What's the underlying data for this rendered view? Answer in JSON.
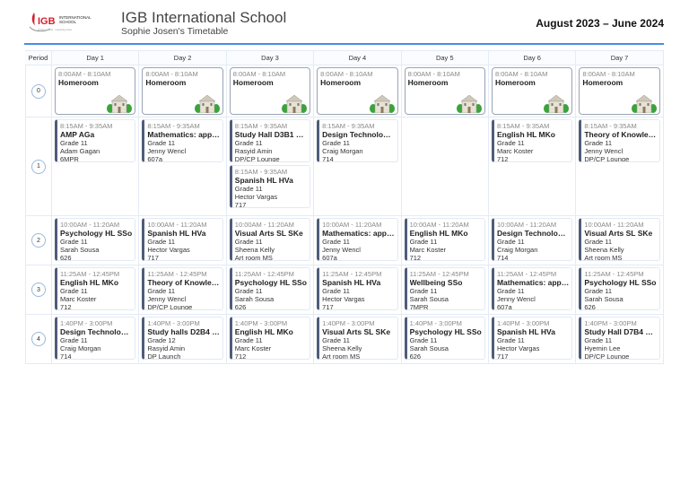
{
  "header": {
    "logo_text": "IGB INTERNATIONAL SCHOOL",
    "title": "IGB International School",
    "subtitle": "Sophie Josen's Timetable",
    "date_range": "August 2023 – June 2024"
  },
  "columns": [
    "Period",
    "Day 1",
    "Day 2",
    "Day 3",
    "Day 4",
    "Day 5",
    "Day 6",
    "Day 7"
  ],
  "periods": [
    {
      "num": "0",
      "days": [
        [
          {
            "time": "8:00AM - 8:10AM",
            "name": "Homeroom",
            "icon": "school-building-icon"
          }
        ],
        [
          {
            "time": "8:00AM - 8:10AM",
            "name": "Homeroom",
            "icon": "school-building-icon"
          }
        ],
        [
          {
            "time": "8:00AM - 8:10AM",
            "name": "Homeroom",
            "icon": "school-building-icon"
          }
        ],
        [
          {
            "time": "8:00AM - 8:10AM",
            "name": "Homeroom",
            "icon": "school-building-icon"
          }
        ],
        [
          {
            "time": "8:00AM - 8:10AM",
            "name": "Homeroom",
            "icon": "school-building-icon"
          }
        ],
        [
          {
            "time": "8:00AM - 8:10AM",
            "name": "Homeroom",
            "icon": "school-building-icon"
          }
        ],
        [
          {
            "time": "8:00AM - 8:10AM",
            "name": "Homeroom",
            "icon": "school-building-icon"
          }
        ]
      ]
    },
    {
      "num": "1",
      "days": [
        [
          {
            "time": "8:15AM - 9:35AM",
            "name": "AMP AGa",
            "grade": "Grade 11",
            "teacher": "Adam Gagan",
            "room": "6MPR"
          }
        ],
        [
          {
            "time": "8:15AM - 9:35AM",
            "name": "Mathematics: appli...",
            "grade": "Grade 11",
            "teacher": "Jenny Wencl",
            "room": "607a"
          }
        ],
        [
          {
            "time": "8:15AM - 9:35AM",
            "name": "Study Hall D3B1 RAm",
            "grade": "Grade 11",
            "teacher": "Rasyid Amin",
            "room": "DP/CP Lounge"
          },
          {
            "time": "8:15AM - 9:35AM",
            "name": "Spanish HL HVa",
            "grade": "Grade 11",
            "teacher": "Hector Vargas",
            "room": "717"
          }
        ],
        [
          {
            "time": "8:15AM - 9:35AM",
            "name": "Design Technology ...",
            "grade": "Grade 11",
            "teacher": "Craig Morgan",
            "room": "714"
          }
        ],
        [],
        [
          {
            "time": "8:15AM - 9:35AM",
            "name": "English HL MKo",
            "grade": "Grade 11",
            "teacher": "Marc Koster",
            "room": "712"
          }
        ],
        [
          {
            "time": "8:15AM - 9:35AM",
            "name": "Theory of Knowled...",
            "grade": "Grade 11",
            "teacher": "Jenny Wencl",
            "room": "DP/CP Lounge"
          }
        ]
      ]
    },
    {
      "num": "2",
      "days": [
        [
          {
            "time": "10:00AM - 11:20AM",
            "name": "Psychology HL SSo",
            "grade": "Grade 11",
            "teacher": "Sarah Sousa",
            "room": "626"
          }
        ],
        [
          {
            "time": "10:00AM - 11:20AM",
            "name": "Spanish HL HVa",
            "grade": "Grade 11",
            "teacher": "Hector Vargas",
            "room": "717"
          }
        ],
        [
          {
            "time": "10:00AM - 11:20AM",
            "name": "Visual Arts SL SKe",
            "grade": "Grade 11",
            "teacher": "Sheena Kelly",
            "room": "Art room MS"
          }
        ],
        [
          {
            "time": "10:00AM - 11:20AM",
            "name": "Mathematics: appli...",
            "grade": "Grade 11",
            "teacher": "Jenny Wencl",
            "room": "607a"
          }
        ],
        [
          {
            "time": "10:00AM - 11:20AM",
            "name": "English HL MKo",
            "grade": "Grade 11",
            "teacher": "Marc Koster",
            "room": "712"
          }
        ],
        [
          {
            "time": "10:00AM - 11:20AM",
            "name": "Design Technology ...",
            "grade": "Grade 11",
            "teacher": "Craig Morgan",
            "room": "714"
          }
        ],
        [
          {
            "time": "10:00AM - 11:20AM",
            "name": "Visual Arts SL SKe",
            "grade": "Grade 11",
            "teacher": "Sheena Kelly",
            "room": "Art room MS"
          }
        ]
      ]
    },
    {
      "num": "3",
      "days": [
        [
          {
            "time": "11:25AM - 12:45PM",
            "name": "English HL MKo",
            "grade": "Grade 11",
            "teacher": "Marc Koster",
            "room": "712"
          }
        ],
        [
          {
            "time": "11:25AM - 12:45PM",
            "name": "Theory of Knowled...",
            "grade": "Grade 11",
            "teacher": "Jenny Wencl",
            "room": "DP/CP Lounge"
          }
        ],
        [
          {
            "time": "11:25AM - 12:45PM",
            "name": "Psychology HL SSo",
            "grade": "Grade 11",
            "teacher": "Sarah Sousa",
            "room": "626"
          }
        ],
        [
          {
            "time": "11:25AM - 12:45PM",
            "name": "Spanish HL HVa",
            "grade": "Grade 11",
            "teacher": "Hector Vargas",
            "room": "717"
          }
        ],
        [
          {
            "time": "11:25AM - 12:45PM",
            "name": "Wellbeing SSo",
            "grade": "Grade 11",
            "teacher": "Sarah Sousa",
            "room": "7MPR"
          }
        ],
        [
          {
            "time": "11:25AM - 12:45PM",
            "name": "Mathematics: appli...",
            "grade": "Grade 11",
            "teacher": "Jenny Wencl",
            "room": "607a"
          }
        ],
        [
          {
            "time": "11:25AM - 12:45PM",
            "name": "Psychology HL SSo",
            "grade": "Grade 11",
            "teacher": "Sarah Sousa",
            "room": "626"
          }
        ]
      ]
    },
    {
      "num": "4",
      "days": [
        [
          {
            "time": "1:40PM - 3:00PM",
            "name": "Design Technology ...",
            "grade": "Grade 11",
            "teacher": "Craig Morgan",
            "room": "714"
          }
        ],
        [
          {
            "time": "1:40PM - 3:00PM",
            "name": "Study halls D2B4 R...",
            "grade": "Grade 12",
            "teacher": "Rasyid Amin",
            "room": "DP Launch"
          }
        ],
        [
          {
            "time": "1:40PM - 3:00PM",
            "name": "English HL MKo",
            "grade": "Grade 11",
            "teacher": "Marc Koster",
            "room": "712"
          }
        ],
        [
          {
            "time": "1:40PM - 3:00PM",
            "name": "Visual Arts SL SKe",
            "grade": "Grade 11",
            "teacher": "Sheena Kelly",
            "room": "Art room MS"
          }
        ],
        [
          {
            "time": "1:40PM - 3:00PM",
            "name": "Psychology HL SSo",
            "grade": "Grade 11",
            "teacher": "Sarah Sousa",
            "room": "626"
          }
        ],
        [
          {
            "time": "1:40PM - 3:00PM",
            "name": "Spanish HL HVa",
            "grade": "Grade 11",
            "teacher": "Hector Vargas",
            "room": "717"
          }
        ],
        [
          {
            "time": "1:40PM - 3:00PM",
            "name": "Study Hall D7B4 HLe",
            "grade": "Grade 11",
            "teacher": "Hyemin Lee",
            "room": "DP/CP Lounge"
          }
        ]
      ]
    }
  ],
  "colors": {
    "accent": "#4a8ae8",
    "card_bar": "#4f5d78",
    "logo_red": "#d4202a"
  }
}
